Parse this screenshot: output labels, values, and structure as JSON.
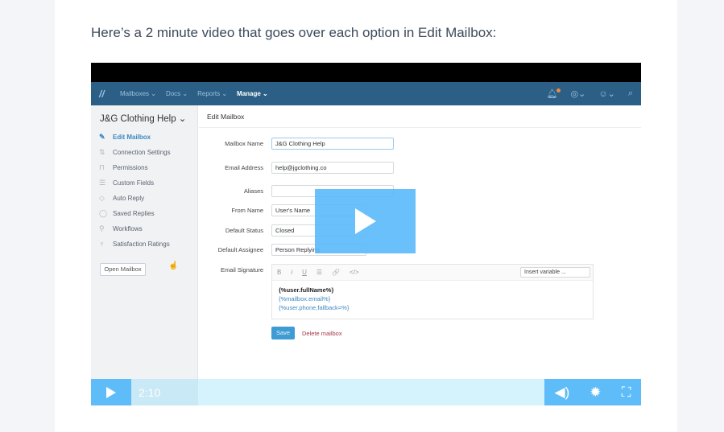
{
  "intro": "Here’s a 2 minute video that goes over each option in Edit Mailbox:",
  "nav": {
    "items": [
      "Mailboxes ⌄",
      "Docs ⌄",
      "Reports ⌄",
      "Manage ⌄"
    ]
  },
  "sidebar": {
    "title": "J&G Clothing Help ⌄",
    "items": [
      {
        "label": "Edit Mailbox",
        "icon": "pencil-icon"
      },
      {
        "label": "Connection Settings",
        "icon": "plug-icon"
      },
      {
        "label": "Permissions",
        "icon": "lock-icon"
      },
      {
        "label": "Custom Fields",
        "icon": "database-icon"
      },
      {
        "label": "Auto Reply",
        "icon": "shield-check-icon"
      },
      {
        "label": "Saved Replies",
        "icon": "chat-icon"
      },
      {
        "label": "Workflows",
        "icon": "workflow-icon"
      },
      {
        "label": "Satisfaction Ratings",
        "icon": "trophy-icon"
      }
    ],
    "open_button": "Open Mailbox"
  },
  "main": {
    "title": "Edit Mailbox",
    "fields": [
      {
        "label": "Mailbox Name",
        "value": "J&G Clothing Help"
      },
      {
        "label": "Email Address",
        "value": "help@jgclothing.co"
      },
      {
        "label": "Aliases",
        "value": ""
      },
      {
        "label": "From Name",
        "value": "User's Name"
      },
      {
        "label": "Default Status",
        "value": "Closed"
      },
      {
        "label": "Default Assignee",
        "value": "Person Replying"
      }
    ],
    "signature_label": "Email Signature",
    "toolbar": [
      "B",
      "i",
      "U",
      "☰",
      "🔗",
      "</>"
    ],
    "insert_variable": "Insert variable ...",
    "signature": [
      "{%user.fullName%}",
      "{%mailbox.email%}",
      "{%user.phone,fallback=%}"
    ],
    "save": "Save",
    "delete": "Delete mailbox"
  },
  "player": {
    "time": "2:10"
  }
}
